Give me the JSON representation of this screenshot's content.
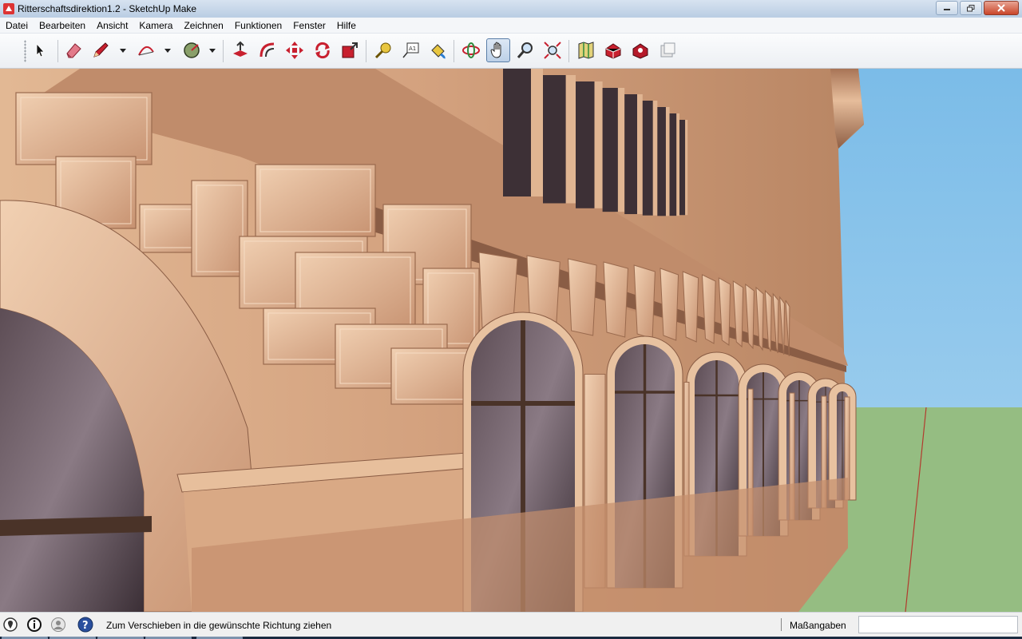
{
  "window": {
    "title": "Ritterschaftsdirektion1.2 - SketchUp Make",
    "icon": "sketchup-logo-icon",
    "controls": [
      "minimize-icon",
      "restore-icon",
      "close-icon"
    ]
  },
  "menu": {
    "items": [
      "Datei",
      "Bearbeiten",
      "Ansicht",
      "Kamera",
      "Zeichnen",
      "Funktionen",
      "Fenster",
      "Hilfe"
    ]
  },
  "toolbar": {
    "tools": [
      {
        "name": "select-tool",
        "icon": "arrow-cursor-icon"
      },
      {
        "name": "eraser-tool",
        "icon": "eraser-icon"
      },
      {
        "name": "line-tool",
        "icon": "pencil-icon",
        "dropdown": true
      },
      {
        "name": "arc-tool",
        "icon": "arc-icon",
        "dropdown": true
      },
      {
        "name": "shape-tool",
        "icon": "circle-icon",
        "dropdown": true
      },
      {
        "name": "push-pull-tool",
        "icon": "push-pull-icon"
      },
      {
        "name": "offset-tool",
        "icon": "offset-icon"
      },
      {
        "name": "move-tool",
        "icon": "move-arrows-icon"
      },
      {
        "name": "rotate-tool",
        "icon": "rotate-icon"
      },
      {
        "name": "scale-tool",
        "icon": "scale-icon"
      },
      {
        "name": "tape-measure-tool",
        "icon": "tape-measure-icon"
      },
      {
        "name": "text-tool",
        "icon": "text-label-icon"
      },
      {
        "name": "paint-bucket-tool",
        "icon": "paint-bucket-icon"
      },
      {
        "name": "orbit-tool",
        "icon": "orbit-icon"
      },
      {
        "name": "pan-tool",
        "icon": "hand-icon",
        "active": true
      },
      {
        "name": "zoom-tool",
        "icon": "magnifier-icon"
      },
      {
        "name": "zoom-extents-tool",
        "icon": "zoom-extents-icon"
      },
      {
        "name": "geo-location-tool",
        "icon": "map-icon"
      },
      {
        "name": "warehouse-tool",
        "icon": "warehouse-icon"
      },
      {
        "name": "extension-warehouse-tool",
        "icon": "extension-icon"
      },
      {
        "name": "send-to-layout-tool",
        "icon": "layout-icon"
      }
    ]
  },
  "statusbar": {
    "icons": [
      "geolocation-status-icon",
      "credits-info-icon",
      "user-account-icon",
      "help-icon"
    ],
    "message": "Zum Verschieben in die gewünschte Richtung ziehen",
    "measurements_label": "Maßangaben",
    "measurements_value": ""
  },
  "colors": {
    "sky": "#87c3ea",
    "ground": "#95bd82",
    "stone_light": "#ecc3a0",
    "stone_mid": "#c99574",
    "stone_dark": "#8a5d45",
    "red_axis": "#b23a2e",
    "active_tool_bg": "#bcd0e7"
  }
}
